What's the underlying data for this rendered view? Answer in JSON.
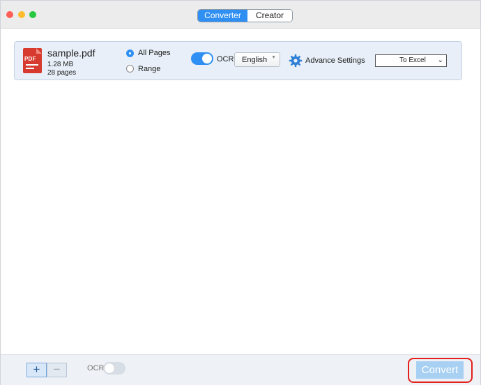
{
  "tabs": {
    "converter": "Converter",
    "creator": "Creator",
    "active": "Converter"
  },
  "file": {
    "name": "sample.pdf",
    "size": "1.28 MB",
    "pages": "28 pages",
    "icon_text": "PDF"
  },
  "page_range": {
    "all_label": "All Pages",
    "range_label": "Range",
    "selected": "All Pages"
  },
  "ocr": {
    "label": "OCR",
    "enabled": true,
    "language": "English"
  },
  "advanced": {
    "label": "Advance Settings"
  },
  "output_format": {
    "value": "To Excel"
  },
  "bottom": {
    "add_label": "+",
    "remove_label": "−",
    "ocr_label": "OCR",
    "ocr_enabled": false,
    "convert_label": "Convert"
  },
  "colors": {
    "accent": "#2f8ff2",
    "highlight": "#e3201c",
    "pdf_red": "#d73b2f"
  },
  "icons": [
    "pdf-file-icon",
    "gear-icon",
    "chevron-down-icon"
  ]
}
